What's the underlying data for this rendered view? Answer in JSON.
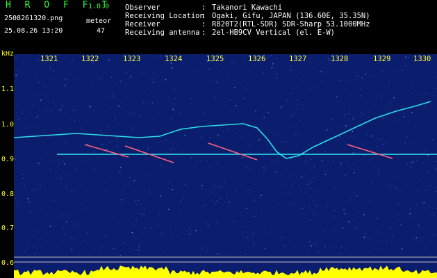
{
  "app": {
    "logo": "H R O F F T",
    "version": "1.0.0"
  },
  "file": {
    "name": "2508261320.png",
    "datetime": "25.08.26 13:20"
  },
  "counter": {
    "label": "meteor",
    "value": "47"
  },
  "info": [
    {
      "label": "Observer",
      "value": "Takanori Kawachi"
    },
    {
      "label": "Receiving Location",
      "value": "Ogaki, Gifu, JAPAN (136.60E, 35.35N)"
    },
    {
      "label": "Receiver",
      "value": "R820T2(RTL-SDR) SDR-Sharp 53.1000MHz"
    },
    {
      "label": "Receiving antenna",
      "value": "2el-HB9CV Vertical (el. E-W)"
    }
  ],
  "info_separator": ":",
  "axis": {
    "y_unit": "kHz",
    "y_ticks": [
      "1.1",
      "1.0",
      "0.9",
      "0.8",
      "0.7",
      "0.6"
    ],
    "x_ticks": [
      "1321",
      "1322",
      "1323",
      "1324",
      "1325",
      "1326",
      "1327",
      "1328",
      "1329",
      "1330"
    ]
  },
  "colors": {
    "background": "#000000",
    "spectrogram_bg": "#0b1e6e",
    "axis_text": "#ffff33",
    "header_green": "#3cf23c",
    "header_text": "#ffffff",
    "signal_cyan": "#33ffff",
    "meteor_echo": "#ff5070",
    "level_bar": "#ffff00"
  }
}
